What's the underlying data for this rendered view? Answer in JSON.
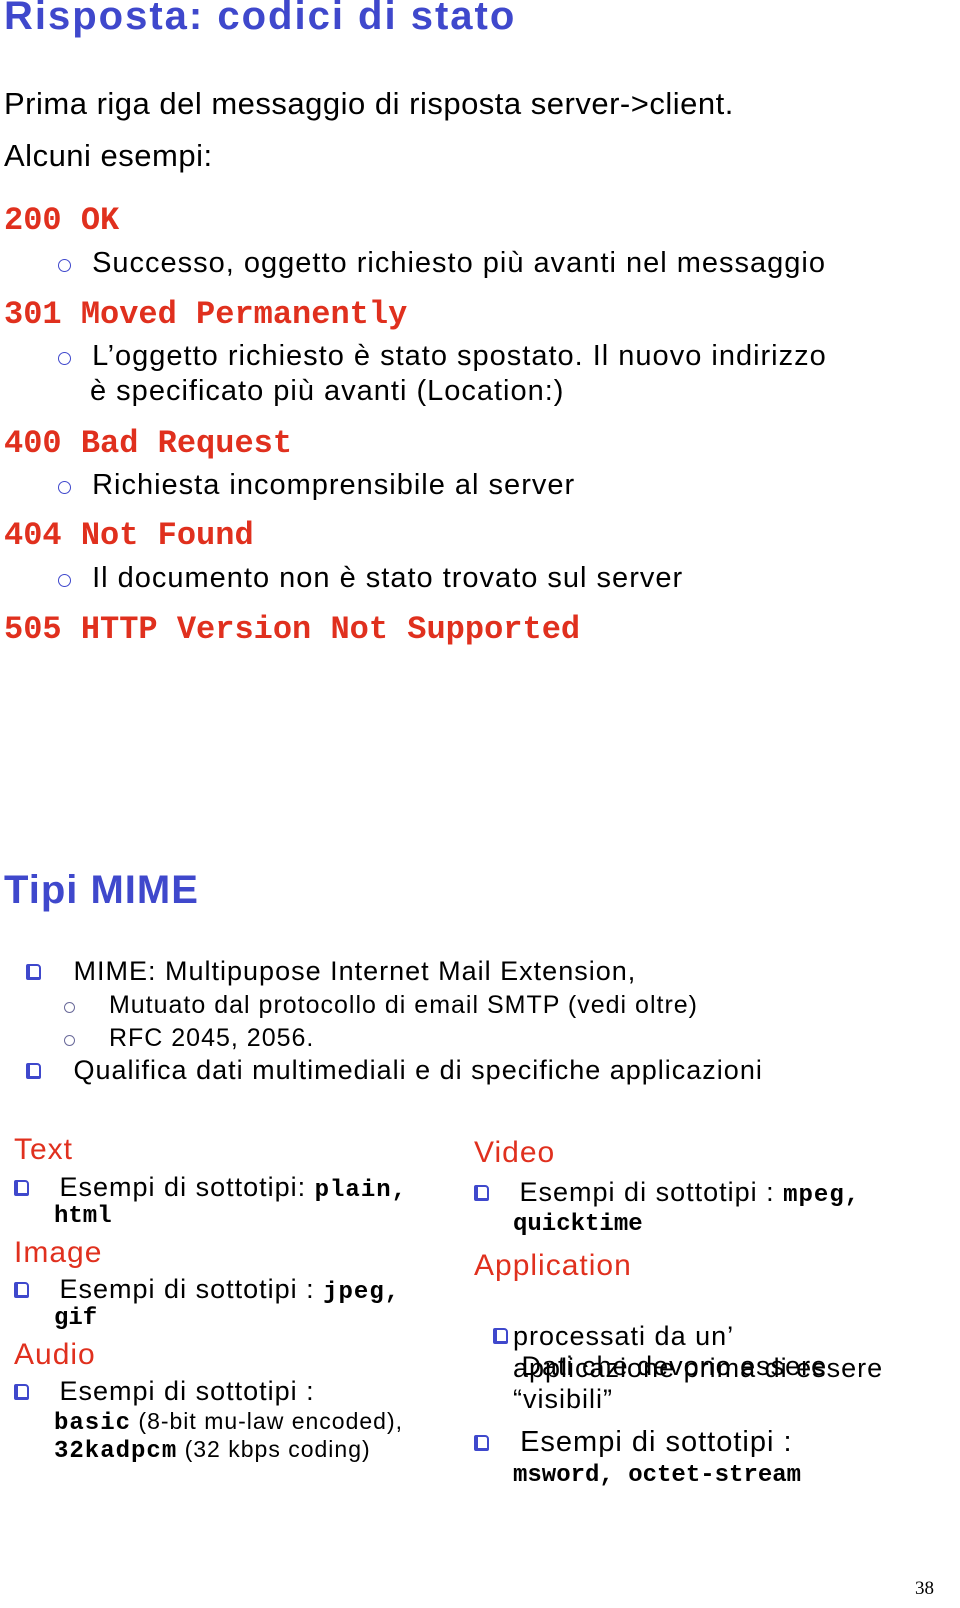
{
  "slide1": {
    "title": "Risposta: codici di stato",
    "intro_line1": "Prima riga del messaggio di risposta server->client.",
    "intro_line2": "Alcuni esempi:",
    "codes": [
      {
        "code": "200 OK",
        "desc": [
          "Successo, oggetto richiesto più avanti nel messaggio"
        ]
      },
      {
        "code": "301 Moved Permanently",
        "desc": [
          "L’oggetto richiesto è stato spostato. Il nuovo indirizzo",
          "è specificato più avanti (Location:)"
        ]
      },
      {
        "code": "400 Bad Request",
        "desc": [
          "Richiesta incomprensibile al server"
        ]
      },
      {
        "code": "404 Not Found",
        "desc": [
          "Il documento non è stato trovato sul server"
        ]
      },
      {
        "code": "505 HTTP Version Not Supported",
        "desc": []
      }
    ]
  },
  "slide2": {
    "title": "Tipi MIME",
    "bullets": [
      {
        "text": "MIME: Multipupose Internet Mail Extension,",
        "subs": [
          "Mutuato dal protocollo di email SMTP (vedi oltre)",
          "RFC 2045, 2056."
        ]
      },
      {
        "text": "Qualifica dati multimediali e di specifiche applicazioni",
        "subs": []
      }
    ],
    "left_col": [
      {
        "category": "Text",
        "line1_text": "Esempi di sottotipi: ",
        "line1_code": "plain,",
        "line2_code": "html",
        "line2_text": "",
        "line3_code": "",
        "line3_text": ""
      },
      {
        "category": "Image",
        "line1_text": "Esempi di sottotipi : ",
        "line1_code": "jpeg,",
        "line2_code": "gif",
        "line2_text": "",
        "line3_code": "",
        "line3_text": ""
      },
      {
        "category": "Audio",
        "line1_text": "Esempi di sottotipi :",
        "line1_code": "",
        "line2_code": "basic",
        "line2_text": " (8-bit mu-law encoded),",
        "line3_code": "32kadpcm",
        "line3_text": " (32 kbps coding)"
      }
    ],
    "right_col": {
      "video": {
        "category": "Video",
        "line1_text": "Esempi di sottotipi : ",
        "line1_code": "mpeg,",
        "line2_code": "quicktime"
      },
      "application": {
        "category": "Application",
        "desc_lines": [
          " Dati che devono essere",
          "processati da un’",
          "applicazione prima di essere",
          "“visibili”"
        ],
        "examples_text": "Esempi di sottotipi :",
        "examples_code": "msword, octet-stream"
      }
    },
    "page_number": "38"
  }
}
